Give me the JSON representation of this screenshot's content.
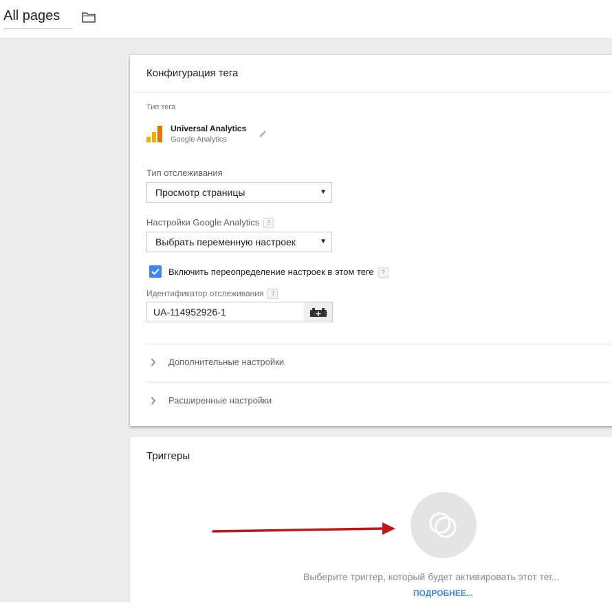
{
  "topbar": {
    "page_name": "All pages",
    "folder_icon": "folder-icon"
  },
  "config_card": {
    "title": "Конфигурация тега",
    "tag_type_label": "Тип тега",
    "tag_type": {
      "name": "Universal Analytics",
      "vendor": "Google Analytics",
      "icon": "google-analytics-logo",
      "edit_icon": "pencil-icon"
    },
    "tracking_type": {
      "label": "Тип отслеживания",
      "value": "Просмотр страницы"
    },
    "ga_settings": {
      "label": "Настройки Google Analytics",
      "value": "Выбрать переменную настроек",
      "help": "?"
    },
    "override": {
      "label": "Включить переопределение настроек в этом теге",
      "checked": true,
      "help": "?"
    },
    "tracking_id": {
      "label": "Идентификатор отслеживания",
      "value": "UA-114952926-1",
      "help": "?",
      "variable_icon": "add-variable-icon"
    },
    "sections": [
      {
        "label": "Дополнительные настройки"
      },
      {
        "label": "Расширенные настройки"
      }
    ]
  },
  "triggers_card": {
    "title": "Триггеры",
    "placeholder": "Выберите триггер, который будет активировать этот тег...",
    "learn_more": "ПОДРОБНЕЕ..."
  },
  "colors": {
    "accent_blue": "#4285f4",
    "arrow_red": "#c0151a",
    "ga_orange": "#f9ab00",
    "ga_dark_orange": "#e37400"
  }
}
